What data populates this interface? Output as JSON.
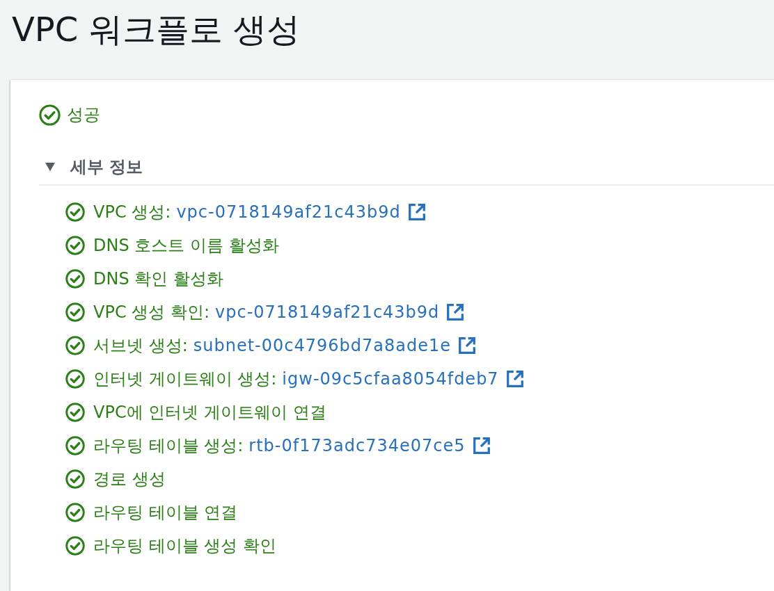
{
  "page": {
    "title": "VPC 워크플로 생성"
  },
  "result": {
    "label": "성공",
    "succeeded": true
  },
  "details": {
    "label": "세부 정보",
    "expanded": true,
    "steps": [
      {
        "label": "VPC 생성:",
        "done": true,
        "resource": "vpc-0718149af21c43b9d"
      },
      {
        "label": "DNS 호스트 이름 활성화",
        "done": true
      },
      {
        "label": "DNS 확인 활성화",
        "done": true
      },
      {
        "label": "VPC 생성 확인:",
        "done": true,
        "resource": "vpc-0718149af21c43b9d"
      },
      {
        "label": "서브넷 생성:",
        "done": true,
        "resource": "subnet-00c4796bd7a8ade1e"
      },
      {
        "label": "인터넷 게이트웨이 생성:",
        "done": true,
        "resource": "igw-09c5cfaa8054fdeb7"
      },
      {
        "label": "VPC에 인터넷 게이트웨이 연결",
        "done": true
      },
      {
        "label": "라우팅 테이블 생성:",
        "done": true,
        "resource": "rtb-0f173adc734e07ce5"
      },
      {
        "label": "경로 생성",
        "done": true
      },
      {
        "label": "라우팅 테이블 연결",
        "done": true
      },
      {
        "label": "라우팅 테이블 생성 확인",
        "done": true
      }
    ]
  }
}
